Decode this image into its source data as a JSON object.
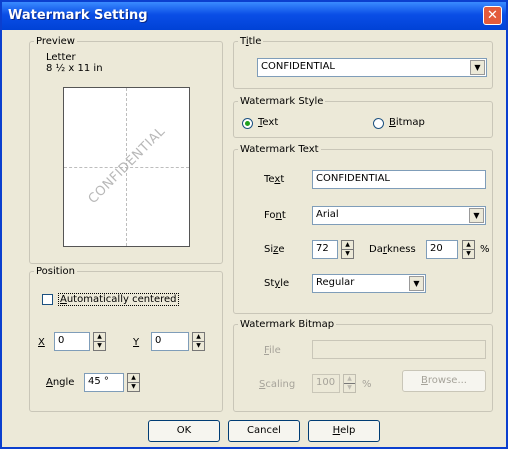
{
  "window": {
    "title": "Watermark Setting",
    "close_glyph": "✕"
  },
  "preview": {
    "legend": "Preview",
    "paper_name": "Letter",
    "paper_size": "8 ½ x 11 in",
    "watermark_text": "CONFIDENTIAL"
  },
  "title_group": {
    "legend": "Title",
    "selected": "CONFIDENTIAL"
  },
  "style_group": {
    "legend": "Watermark Style",
    "text_label": "Text",
    "bitmap_label": "Bitmap",
    "selected": "Text"
  },
  "text_group": {
    "legend": "Watermark Text",
    "text_label": "Text",
    "text_value": "CONFIDENTIAL",
    "font_label": "Font",
    "font_value": "Arial",
    "size_label": "Size",
    "size_value": "72",
    "darkness_label": "Darkness",
    "darkness_value": "20",
    "percent": "%",
    "style_label": "Style",
    "style_value": "Regular"
  },
  "position_group": {
    "legend": "Position",
    "auto_center_label": "Automatically centered",
    "auto_center_checked": false,
    "x_label": "X",
    "x_value": "0",
    "y_label": "Y",
    "y_value": "0",
    "angle_label": "Angle",
    "angle_value": "45 °"
  },
  "bitmap_group": {
    "legend": "Watermark Bitmap",
    "file_label": "File",
    "file_value": "",
    "scaling_label": "Scaling",
    "scaling_value": "100",
    "percent": "%",
    "browse_label": "Browse..."
  },
  "buttons": {
    "ok": "OK",
    "cancel": "Cancel",
    "help": "Help"
  },
  "icons": {
    "dropdown": "chevron-down-icon",
    "spin": "spin-arrows-icon",
    "close": "close-icon"
  }
}
